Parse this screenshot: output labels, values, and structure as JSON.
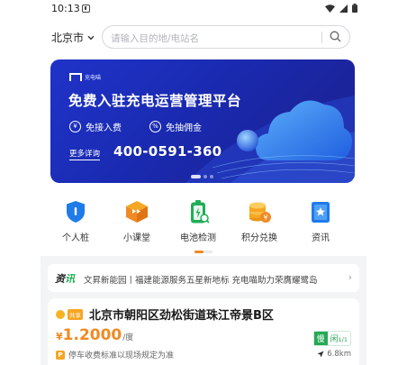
{
  "status_bar": {
    "time": "10:13"
  },
  "header": {
    "city": "北京市",
    "search_placeholder": "请输入目的地/电站名"
  },
  "banner": {
    "logo_text": "充电喵",
    "title": "免费入驻充电运营管理平台",
    "features": [
      "免接入费",
      "免抽佣金"
    ],
    "consult_label": "更多详询",
    "phone": "400-0591-360",
    "page_count": 3,
    "active_page": 0
  },
  "quick_nav": [
    {
      "label": "个人桩",
      "icon": "shield-icon",
      "color": "#1f7be8"
    },
    {
      "label": "小课堂",
      "icon": "class-box-icon",
      "color": "#f08a24"
    },
    {
      "label": "电池检测",
      "icon": "battery-check-icon",
      "color": "#1fae57"
    },
    {
      "label": "积分兑换",
      "icon": "coins-icon",
      "color": "#f5a623"
    },
    {
      "label": "资讯",
      "icon": "news-book-icon",
      "color": "#1f7be8"
    }
  ],
  "news": {
    "badge_prefix": "资",
    "badge_suffix": "讯",
    "text": "文昇新能园丨福建能源服务五星新地标 充电喵助力荣膺耀鹭岛"
  },
  "station": {
    "tag": "共享",
    "name": "北京市朝阳区劲松街道珠江帝景B区",
    "price_currency": "¥",
    "price": "1.2000",
    "price_unit": "/度",
    "slow_label": "慢",
    "slow_status": "闲",
    "slow_count": "1/1",
    "parking_icon": "P",
    "parking_note": "停车收费标准以现场规定为准",
    "distance": "6.8km"
  },
  "colors": {
    "accent": "#f08a24",
    "banner": "#1f33c9",
    "green": "#27a856"
  }
}
